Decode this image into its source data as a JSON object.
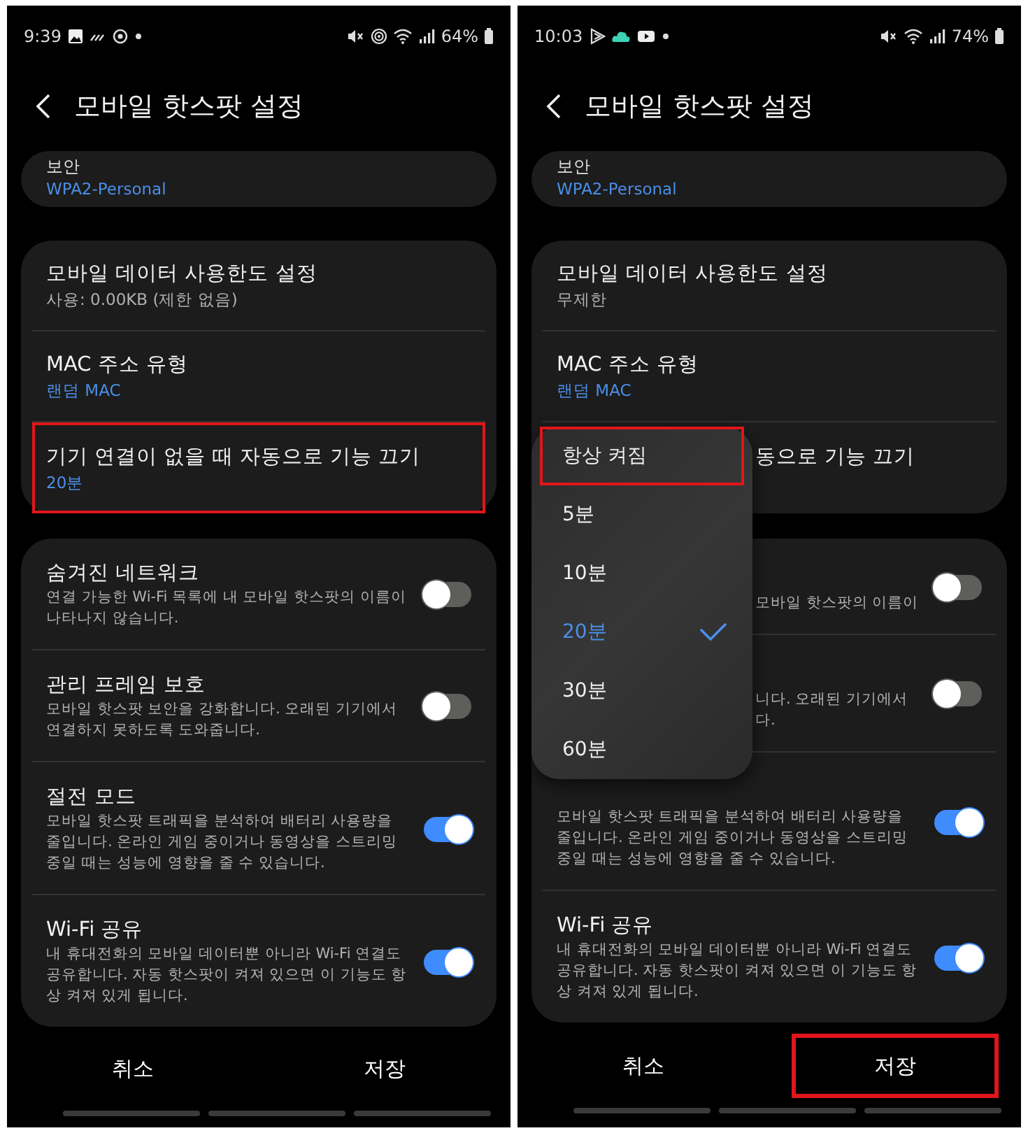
{
  "phones": [
    {
      "status_bar": {
        "time": "9:39",
        "left_icons": [
          {
            "kind": "image"
          },
          {
            "kind": "squiggle"
          },
          {
            "kind": "ring"
          },
          {
            "kind": "dot"
          }
        ],
        "right_icons": [
          {
            "kind": "mute"
          },
          {
            "kind": "hotspot"
          },
          {
            "kind": "wifi"
          },
          {
            "kind": "signal"
          }
        ],
        "battery": "64%"
      },
      "title": "모바일 핫스팟 설정",
      "security": {
        "label": "보안",
        "value": "WPA2-Personal"
      },
      "settings": [
        {
          "title": "모바일 데이터 사용한도 설정",
          "value": "사용: 0.00KB (제한 없음)",
          "color": "#b0b0b0",
          "covered": false,
          "highlighted": false
        },
        {
          "title": "MAC 주소 유형",
          "value": "랜덤 MAC",
          "color": "#4a8fe8",
          "covered": false,
          "highlighted": false
        },
        {
          "title": "기기 연결이 없을 때 자동으로 기능 끄기",
          "value": "20분",
          "color": "#4a8fe8",
          "covered": false,
          "highlighted": true
        }
      ],
      "toggles": [
        {
          "title": "숨겨진 네트워크",
          "description": "연결 가능한 Wi-Fi 목록에 내 모바일 핫스팟의 이름이 나타나지 않습니다.",
          "on": false,
          "covered": false
        },
        {
          "title": "관리 프레임 보호",
          "description": "모바일 핫스팟 보안을 강화합니다. 오래된 기기에서 연결하지 못하도록 도와줍니다.",
          "on": false,
          "covered": false
        },
        {
          "title": "절전 모드",
          "description": "모바일 핫스팟 트래픽을 분석하여 배터리 사용량을 줄입니다. 온라인 게임 중이거나 동영상을 스트리밍 중일 때는 성능에 영향을 줄 수 있습니다.",
          "on": true,
          "covered": false
        },
        {
          "title": "Wi-Fi 공유",
          "description": "내 휴대전화의 모바일 데이터뿐 아니라 Wi-Fi 연결도 공유합니다. 자동 핫스팟이 켜져 있으면 이 기능도 항상 켜져 있게 됩니다.",
          "on": true,
          "covered": false
        }
      ],
      "buttons": [
        {
          "label": "취소",
          "highlighted": false
        },
        {
          "label": "저장",
          "highlighted": false
        }
      ]
    },
    {
      "status_bar": {
        "time": "10:03",
        "left_icons": [
          {
            "kind": "play-outline"
          },
          {
            "kind": "cloud"
          },
          {
            "kind": "video"
          },
          {
            "kind": "dot"
          }
        ],
        "right_icons": [
          {
            "kind": "mute"
          },
          {
            "kind": "wifi"
          },
          {
            "kind": "signal"
          }
        ],
        "battery": "74%"
      },
      "title": "모바일 핫스팟 설정",
      "security": {
        "label": "보안",
        "value": "WPA2-Personal"
      },
      "settings": [
        {
          "title": "모바일 데이터 사용한도 설정",
          "value": "무제한",
          "color": "#b0b0b0",
          "covered": false,
          "highlighted": false
        },
        {
          "title": "MAC 주소 유형",
          "value": "랜덤 MAC",
          "color": "#4a8fe8",
          "covered": false,
          "highlighted": false
        },
        {
          "title": "동으로 기능 끄기",
          "covered": true,
          "highlighted": false
        }
      ],
      "toggles": [
        {
          "description": "모바일 핫스팟의 이름이",
          "on": false,
          "covered": true
        },
        {
          "description": "니다. 오래된 기기에서\n다.",
          "on": false,
          "covered": true
        },
        {
          "description": "모바일 핫스팟 트래픽을 분석하여 배터리 사용량을 줄입니다. 온라인 게임 중이거나 동영상을 스트리밍 중일 때는 성능에 영향을 줄 수 있습니다.",
          "on": true,
          "covered": false
        },
        {
          "title": "Wi-Fi 공유",
          "description": "내 휴대전화의 모바일 데이터뿐 아니라 Wi-Fi 연결도 공유합니다. 자동 핫스팟이 켜져 있으면 이 기능도 항상 켜져 있게 됩니다.",
          "on": true,
          "covered": false
        }
      ],
      "menu": {
        "options": [
          {
            "label": "항상 켜짐",
            "selected": false,
            "highlighted": true
          },
          {
            "label": "5분",
            "selected": false,
            "highlighted": false
          },
          {
            "label": "10분",
            "selected": false,
            "highlighted": false
          },
          {
            "label": "20분",
            "selected": true,
            "highlighted": false
          },
          {
            "label": "30분",
            "selected": false,
            "highlighted": false
          },
          {
            "label": "60분",
            "selected": false,
            "highlighted": false
          }
        ]
      },
      "buttons": [
        {
          "label": "취소",
          "highlighted": false
        },
        {
          "label": "저장",
          "highlighted": true
        }
      ]
    }
  ]
}
